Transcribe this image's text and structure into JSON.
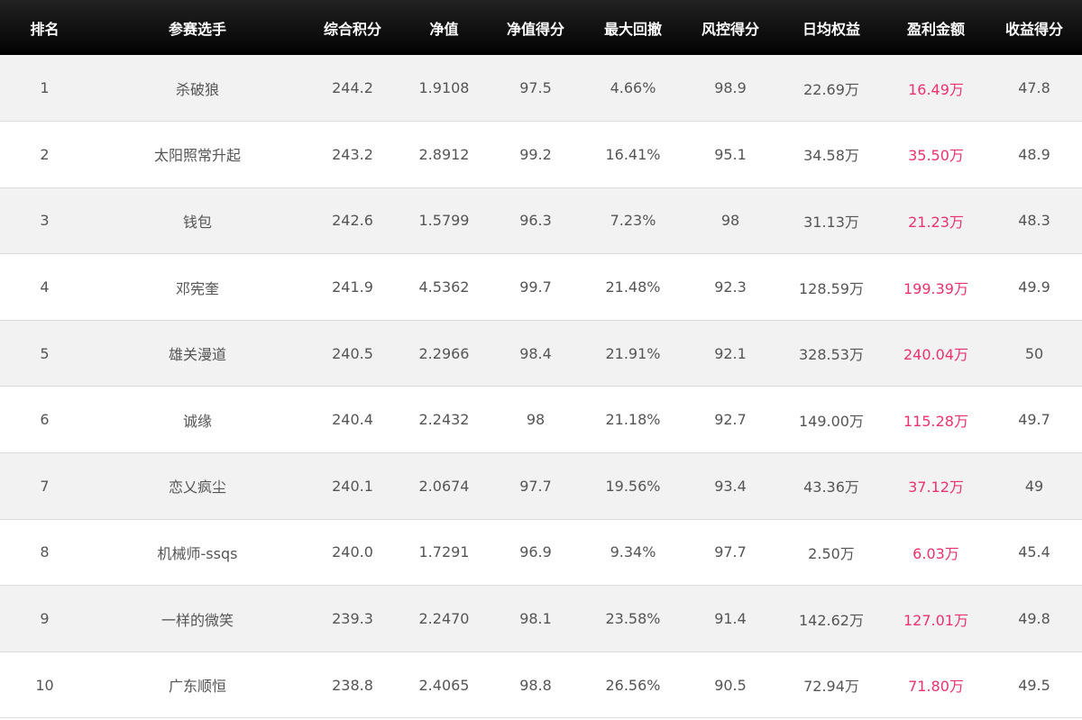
{
  "table": {
    "headers": [
      "排名",
      "参赛选手",
      "综合积分",
      "净值",
      "净值得分",
      "最大回撤",
      "风控得分",
      "日均权益",
      "盈利金额",
      "收益得分"
    ],
    "rows": [
      [
        "1",
        "杀破狼",
        "244.2",
        "1.9108",
        "97.5",
        "4.66%",
        "98.9",
        "22.69万",
        "16.49万",
        "47.8"
      ],
      [
        "2",
        "太阳照常升起",
        "243.2",
        "2.8912",
        "99.2",
        "16.41%",
        "95.1",
        "34.58万",
        "35.50万",
        "48.9"
      ],
      [
        "3",
        "钱包",
        "242.6",
        "1.5799",
        "96.3",
        "7.23%",
        "98",
        "31.13万",
        "21.23万",
        "48.3"
      ],
      [
        "4",
        "邓宪奎",
        "241.9",
        "4.5362",
        "99.7",
        "21.48%",
        "92.3",
        "128.59万",
        "199.39万",
        "49.9"
      ],
      [
        "5",
        "雄关漫道",
        "240.5",
        "2.2966",
        "98.4",
        "21.91%",
        "92.1",
        "328.53万",
        "240.04万",
        "50"
      ],
      [
        "6",
        "诚缘",
        "240.4",
        "2.2432",
        "98",
        "21.18%",
        "92.7",
        "149.00万",
        "115.28万",
        "49.7"
      ],
      [
        "7",
        "恋乂疯尘",
        "240.1",
        "2.0674",
        "97.7",
        "19.56%",
        "93.4",
        "43.36万",
        "37.12万",
        "49"
      ],
      [
        "8",
        "机械师-ssqs",
        "240.0",
        "1.7291",
        "96.9",
        "9.34%",
        "97.7",
        "2.50万",
        "6.03万",
        "45.4"
      ],
      [
        "9",
        "一样的微笑",
        "239.3",
        "2.2470",
        "98.1",
        "23.58%",
        "91.4",
        "142.62万",
        "127.01万",
        "49.8"
      ],
      [
        "10",
        "广东顺恒",
        "238.8",
        "2.4065",
        "98.8",
        "26.56%",
        "90.5",
        "72.94万",
        "71.80万",
        "49.5"
      ]
    ]
  },
  "colors": {
    "header_bg": "#000000",
    "header_text": "#ffffff",
    "row_alt_bg": "#f2f2f2",
    "cell_text": "#555555",
    "profit_text": "#e8336d"
  }
}
